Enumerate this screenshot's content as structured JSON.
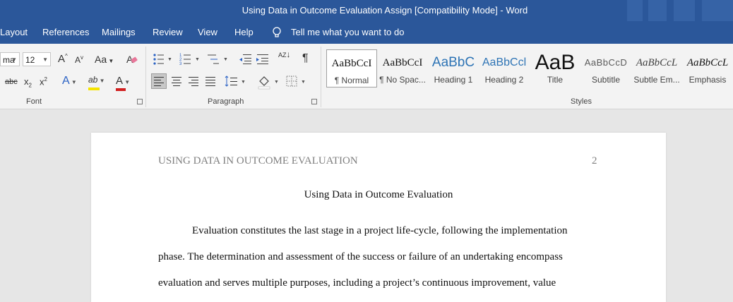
{
  "window": {
    "title": "Using Data in Outcome Evaluation Assign [Compatibility Mode]  -  Word"
  },
  "tabs": [
    "Layout",
    "References",
    "Mailings",
    "Review",
    "View",
    "Help"
  ],
  "tell_me": "Tell me what you want to do",
  "font": {
    "name": "ma",
    "size": "12",
    "grow_label": "A",
    "shrink_label": "A",
    "case_label": "Aa",
    "strike_label": "abc",
    "subscript_label": "x",
    "subscript_suffix": "2",
    "superscript_label": "x",
    "superscript_suffix": "2",
    "effects_label": "A",
    "highlight_label": "ab",
    "color_label": "A",
    "group_label": "Font",
    "highlight_color": "#f5e400",
    "font_color": "#d11f1f"
  },
  "paragraph": {
    "group_label": "Paragraph",
    "pilcrow": "¶",
    "sort_letters": "AZ"
  },
  "styles": {
    "group_label": "Styles",
    "items": [
      {
        "preview": "AaBbCcI",
        "name": "¶ Normal"
      },
      {
        "preview": "AaBbCcI",
        "name": "¶ No Spac..."
      },
      {
        "preview": "AaBbC",
        "name": "Heading 1"
      },
      {
        "preview": "AaBbCcl",
        "name": "Heading 2"
      },
      {
        "preview": "AaB",
        "name": "Title"
      },
      {
        "preview": "AaBbCcD",
        "name": "Subtitle"
      },
      {
        "preview": "AaBbCcL",
        "name": "Subtle Em..."
      },
      {
        "preview": "AaBbCcL",
        "name": "Emphasis"
      }
    ]
  },
  "document": {
    "running_head": "USING DATA IN OUTCOME EVALUATION",
    "page_number": "2",
    "title": "Using Data in Outcome Evaluation",
    "lines": [
      "Evaluation constitutes the last stage in a project life-cycle, following the implementation",
      "phase. The determination and assessment of the success or failure of an undertaking encompass",
      "evaluation and serves multiple purposes, including a project’s continuous improvement, value"
    ]
  },
  "colors": {
    "accent": "#2b579a",
    "ribbon": "#f3f3f3",
    "canvas": "#e6e6e6"
  }
}
